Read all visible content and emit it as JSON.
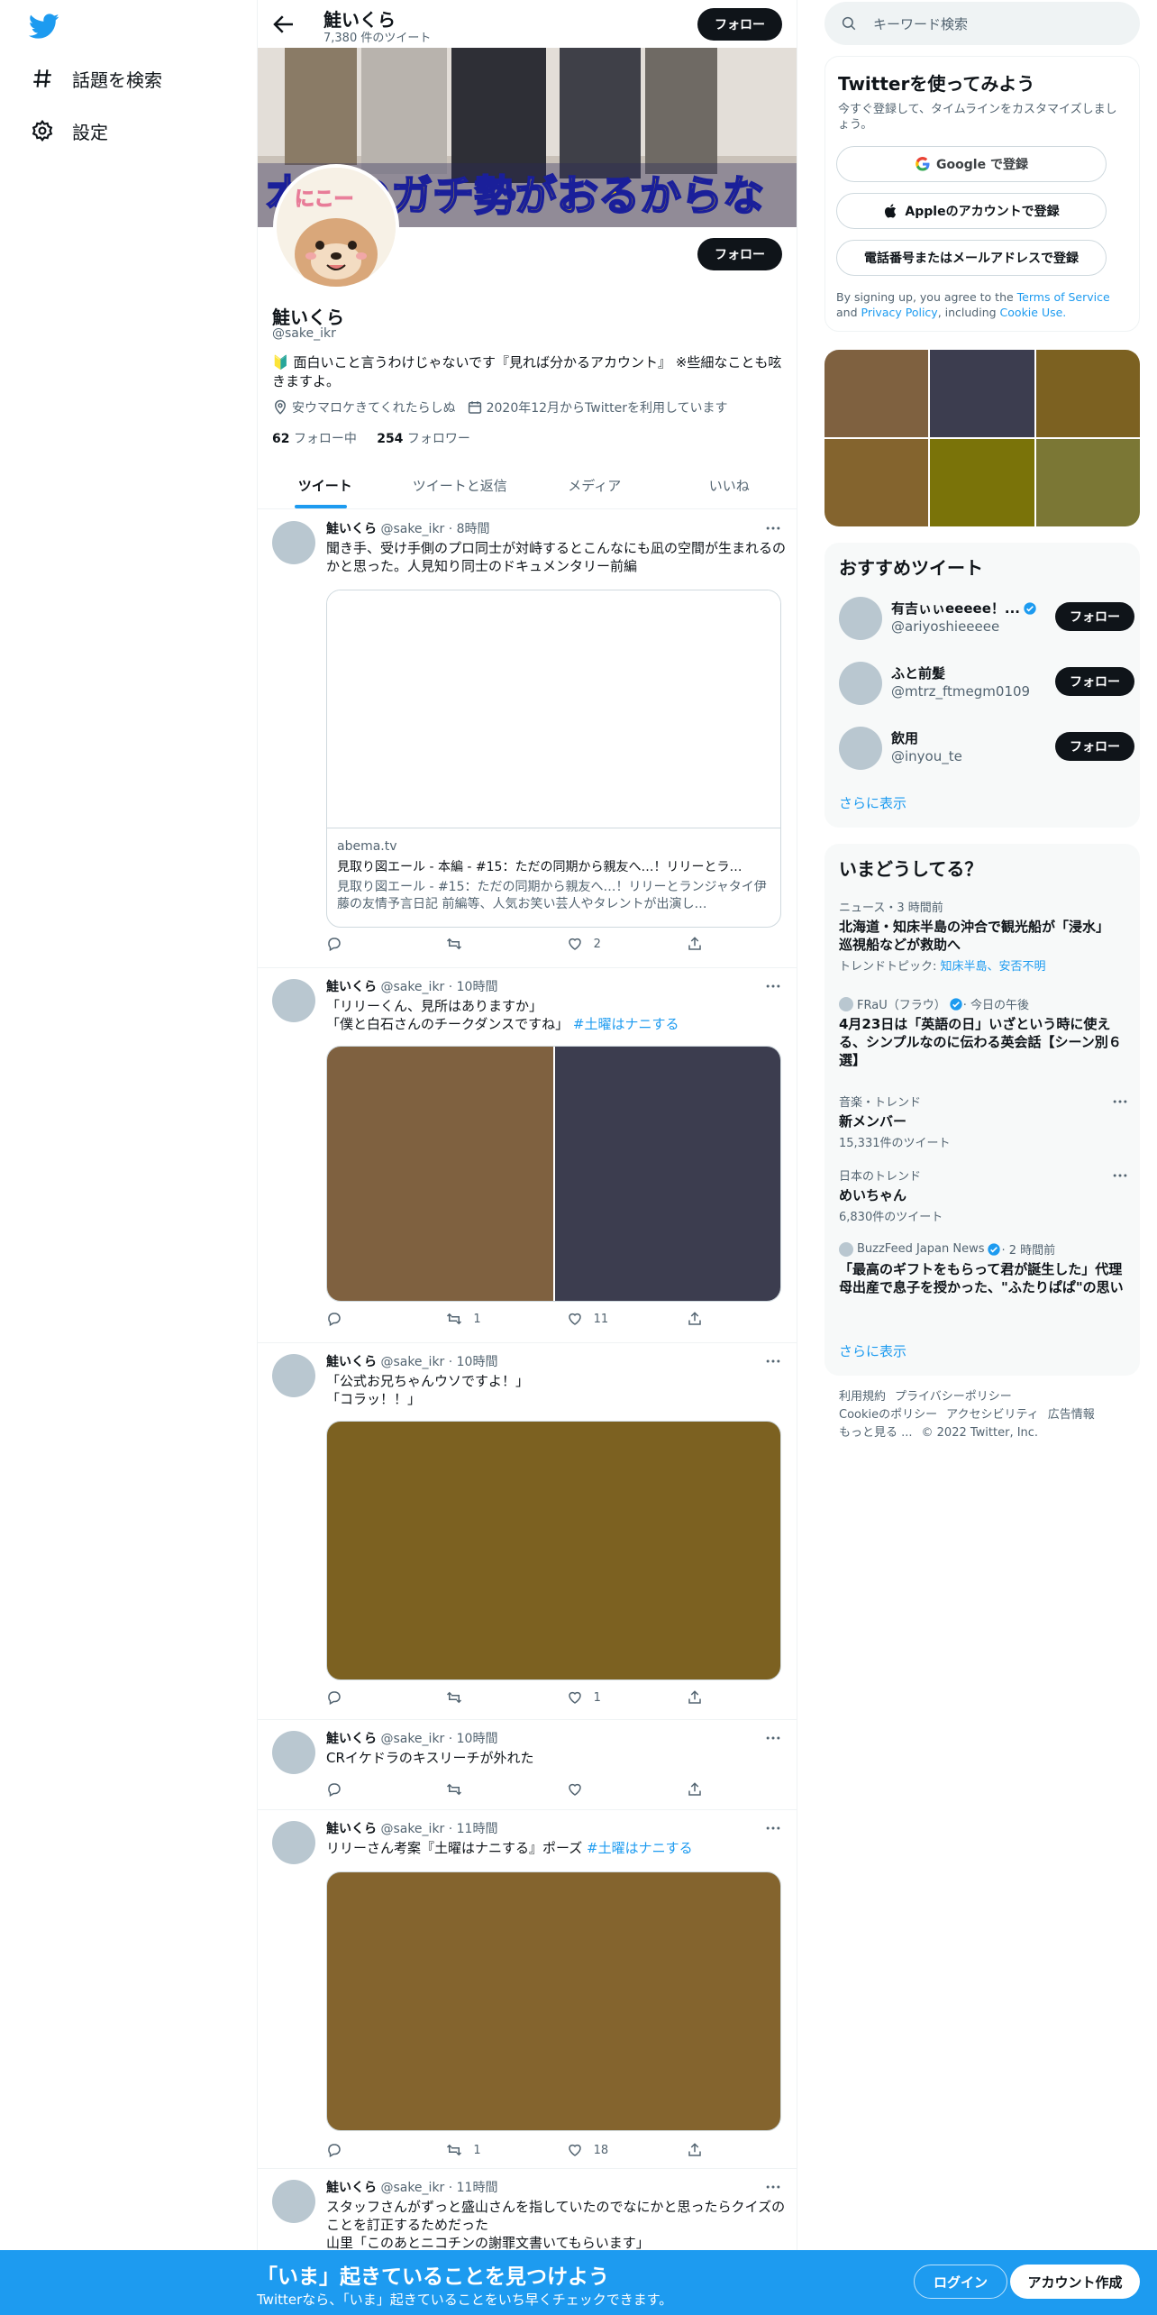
{
  "nav": {
    "explore_label": "話題を検索",
    "settings_label": "設定"
  },
  "header": {
    "name": "鮭いくら",
    "tweet_count": "7,380 件のツイート",
    "follow_label": "フォロー"
  },
  "banner": {
    "caption": "本気のガチ勢がおるからな",
    "avatar_text": "にこー"
  },
  "profile": {
    "name": "鮭いくら",
    "handle": "@sake_ikr",
    "bio": "🔰 面白いこと言うわけじゃないです『見れば分かるアカウント』 ※些細なことも呟きますよ。",
    "location": "安ウマロケきてくれたらしぬ",
    "joined": "2020年12月からTwitterを利用しています",
    "following_count": "62",
    "following_label": "フォロー中",
    "followers_count": "254",
    "followers_label": "フォロワー",
    "follow_label": "フォロー"
  },
  "tabs": [
    "ツイート",
    "ツイートと返信",
    "メディア",
    "いいね"
  ],
  "tweets": [
    {
      "name": "鮭いくら",
      "handle": "@sake_ikr · 8時間",
      "text": "聞き手、受け手側のプロ同士が対峙するとこんなにも凪の空間が生まれるのかと思った。人見知り同士のドキュメンタリー前編",
      "card": {
        "domain": "abema.tv",
        "title": "見取り図エール - 本編 - #15：ただの同期から親友へ…！リリーとラ…",
        "desc": "見取り図エール - #15：ただの同期から親友へ…！リリーとランジャタイ伊藤の友情予言日記 前編等、人気お笑い芸人やタレントが出演し…"
      },
      "replies": "",
      "retweets": "",
      "likes": "2"
    },
    {
      "name": "鮭いくら",
      "handle": "@sake_ikr · 10時間",
      "text_line1": "「リリーくん、見所はありますか」",
      "text_line2": "「僕と白石さんのチークダンスですね」",
      "hashtag": "#土曜はナニする",
      "replies": "",
      "retweets": "1",
      "likes": "11"
    },
    {
      "name": "鮭いくら",
      "handle": "@sake_ikr · 10時間",
      "text_line1": "「公式お兄ちゃんウソですよ！」",
      "text_line2": "「コラッ！！」",
      "replies": "",
      "retweets": "",
      "likes": "1"
    },
    {
      "name": "鮭いくら",
      "handle": "@sake_ikr · 10時間",
      "text": "CRイケドラのキスリーチが外れた",
      "replies": "",
      "retweets": "",
      "likes": ""
    },
    {
      "name": "鮭いくら",
      "handle": "@sake_ikr · 11時間",
      "text": "リリーさん考案『土曜はナニする』ポーズ",
      "hashtag": "#土曜はナニする",
      "replies": "",
      "retweets": "1",
      "likes": "18"
    },
    {
      "name": "鮭いくら",
      "handle": "@sake_ikr · 11時間",
      "text_line1": "スタッフさんがずっと盛山さんを指していたのでなにかと思ったらクイズのことを訂正するためだった",
      "text_line2": "山里「このあとニコチンの謝罪文書いてもらいます」"
    }
  ],
  "right": {
    "search_placeholder": "キーワード検索",
    "signup": {
      "title": "Twitterを使ってみよう",
      "subtitle": "今すぐ登録して、タイムラインをカスタマイズしましょう。",
      "google_label": "Google で登録",
      "apple_label": "Appleのアカウントで登録",
      "phone_label": "電話番号またはメールアドレスで登録",
      "terms_prefix": "By signing up, you agree to the ",
      "terms_link": "Terms of Service",
      "terms_and": " and ",
      "privacy_link": "Privacy Policy",
      "terms_including": ", including ",
      "cookie_link": "Cookie Use."
    },
    "photo_colors": [
      "#7f6140",
      "#3c3d4f",
      "#7c6121",
      "#84642e",
      "#7a7309",
      "#7b7735"
    ],
    "recommend": {
      "title": "おすすめツイート",
      "users": [
        {
          "name": "有吉ぃぃeeeee！...",
          "handle": "@ariyoshieeeee",
          "verified": true,
          "follow": "フォロー"
        },
        {
          "name": "ふと前髪",
          "handle": "@mtrz_ftmegm0109",
          "verified": false,
          "follow": "フォロー"
        },
        {
          "name": "飲用",
          "handle": "@inyou_te",
          "verified": false,
          "follow": "フォロー"
        }
      ],
      "more": "さらに表示"
    },
    "trends": {
      "title": "いまどうしてる？",
      "items": [
        {
          "category": "ニュース・3 時間前",
          "title": "北海道・知床半島の沖合で観光船が「浸水」 巡視船などが救助へ",
          "sub_prefix": "トレンドトピック: ",
          "sub_links": "知床半島、安否不明"
        },
        {
          "category_source": "FRaU（フラウ）",
          "category_time": "· 今日の午後",
          "title": "4月23日は「英語の日」いざという時に使える、シンプルなのに伝わる英会話【シーン別６選】"
        },
        {
          "category": "音楽・トレンド",
          "title": "新メンバー",
          "sub": "15,331件のツイート"
        },
        {
          "category": "日本のトレンド",
          "title": "めいちゃん",
          "sub": "6,830件のツイート"
        },
        {
          "category_source": "BuzzFeed Japan News",
          "category_time": "· 2 時間前",
          "title": "「最高のギフトをもらって君が誕生した」代理母出産で息子を授かった、\"ふたりぱぱ\"の思い"
        }
      ],
      "more": "さらに表示"
    },
    "footer": {
      "terms": "利用規約",
      "privacy": "プライバシーポリシー",
      "cookie": "Cookieのポリシー",
      "accessibility": "アクセシビリティ",
      "ads": "広告情報",
      "more": "もっと見る ...",
      "copyright": "© 2022 Twitter, Inc."
    }
  },
  "bottombar": {
    "title": "「いま」起きていることを見つけよう",
    "subtitle": "Twitterなら、「いま」起きていることをいち早くチェックできます。",
    "login": "ログイン",
    "signup": "アカウント作成"
  },
  "colors": {
    "accent": "#1d9bf0",
    "text": "#0f1419",
    "muted": "#536471",
    "media_tweet2_left": "#7f6140",
    "media_tweet2_right": "#3c3d4f",
    "media_tweet3": "#7c6121",
    "media_tweet5": "#84642e"
  }
}
